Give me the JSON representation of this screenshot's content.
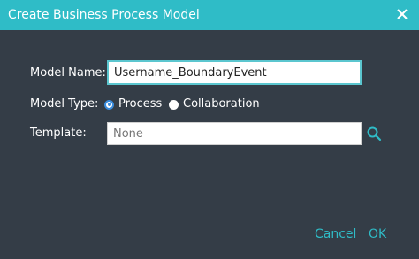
{
  "dialog": {
    "title": "Create Business Process Model",
    "close_icon": "close-icon"
  },
  "form": {
    "model_name_label": "Model Name:",
    "model_name_value": "Username_BoundaryEvent",
    "model_type_label": "Model Type:",
    "model_type_options": [
      {
        "label": "Process",
        "selected": true
      },
      {
        "label": "Collaboration",
        "selected": false
      }
    ],
    "template_label": "Template:",
    "template_placeholder": "None",
    "template_search_icon": "search-icon"
  },
  "footer": {
    "cancel_label": "Cancel",
    "ok_label": "OK"
  },
  "colors": {
    "accent": "#2fbcc7",
    "background": "#343d47",
    "radio_selected": "#3a8dde"
  }
}
